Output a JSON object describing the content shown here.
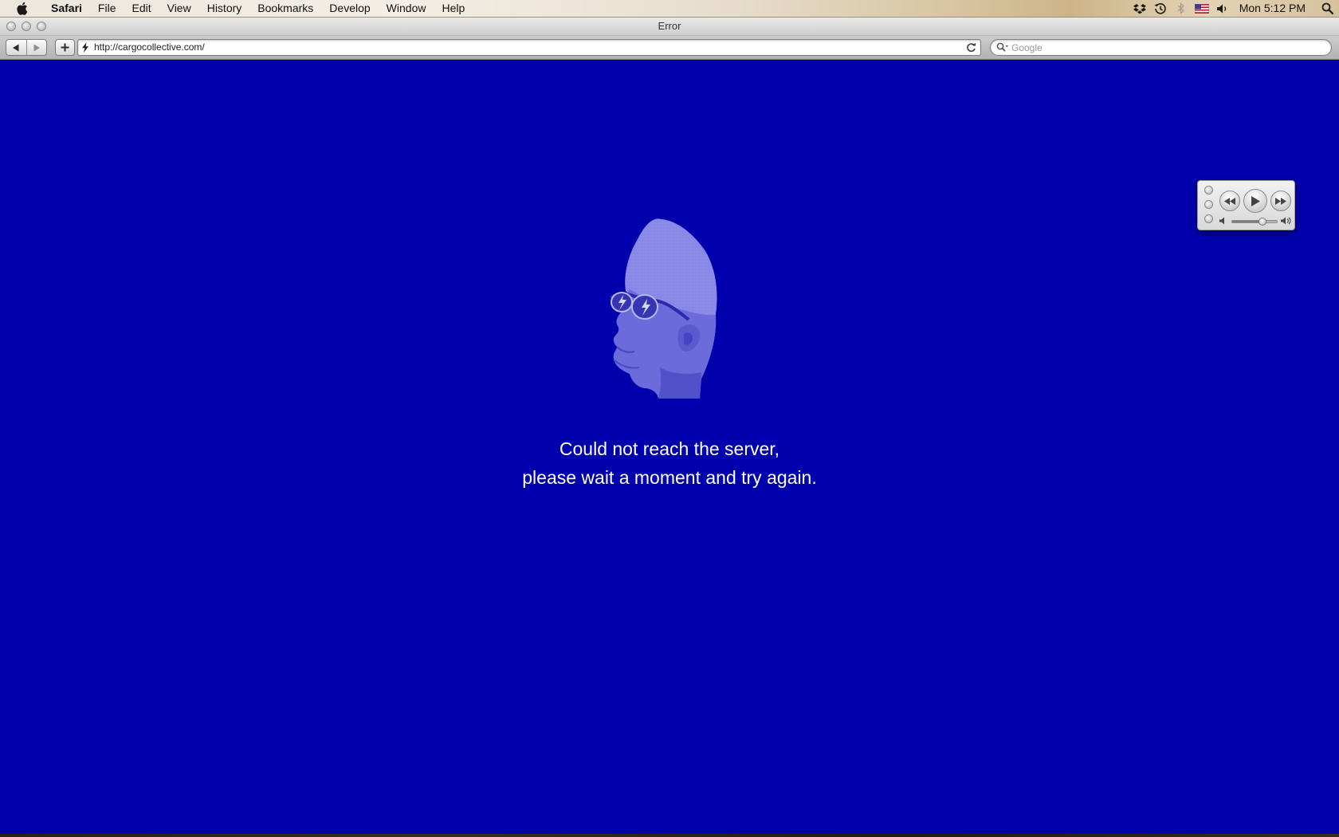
{
  "menubar": {
    "app_name": "Safari",
    "items": [
      "File",
      "Edit",
      "View",
      "History",
      "Bookmarks",
      "Develop",
      "Window",
      "Help"
    ],
    "tray_icons": [
      "dropbox-icon",
      "time-machine-icon",
      "bluetooth-icon",
      "us-flag-input-icon",
      "volume-icon"
    ],
    "clock": "Mon 5:12 PM"
  },
  "window": {
    "title": "Error",
    "url": "http://cargocollective.com/",
    "search_placeholder": "Google",
    "accent_color": "#0000ac"
  },
  "page": {
    "background_color": "#0000ac",
    "message_line1": "Could not reach the server,",
    "message_line2": "please wait a moment and try again.",
    "illustration_color": "#6b6bdc"
  },
  "mini_player": {
    "volume_fraction": 0.68
  }
}
